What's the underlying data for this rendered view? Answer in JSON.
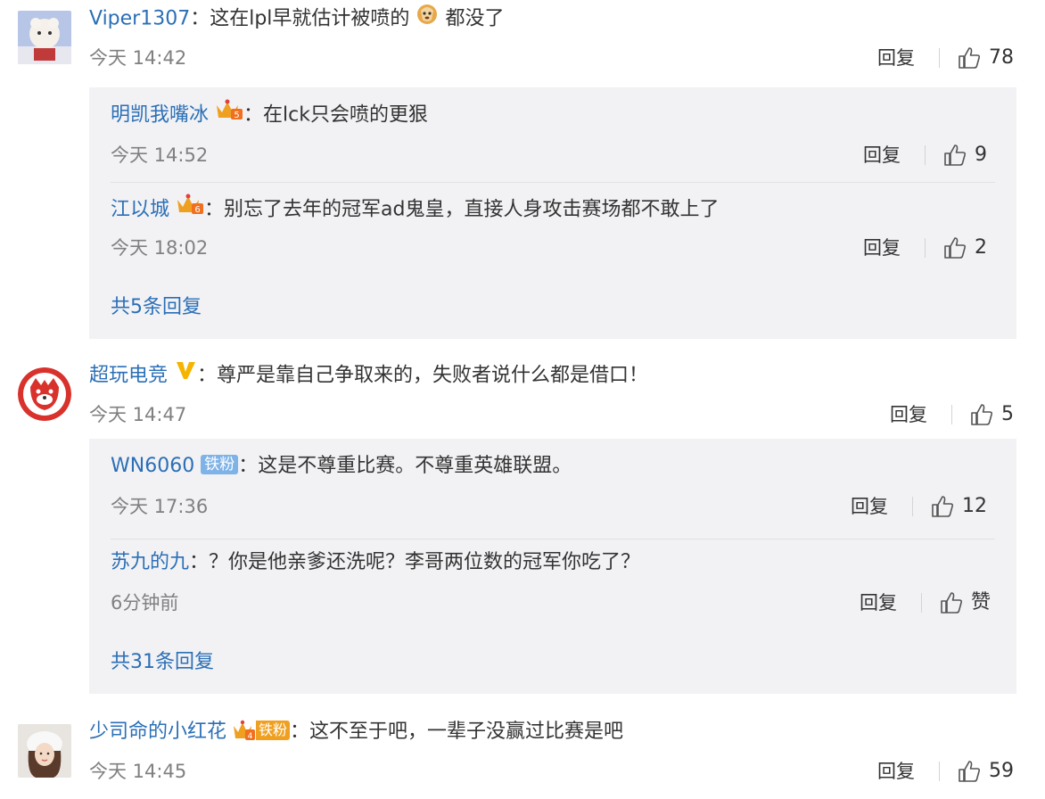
{
  "comments": [
    {
      "user": "Viper1307",
      "colon": "：",
      "text_before": "这在lpl早就估计被喷的",
      "text_after": "都没了",
      "time": "今天 14:42",
      "reply": "回复",
      "likes": "78",
      "replies": [
        {
          "user": "明凯我嘴冰",
          "colon": "：",
          "text": "在lck只会喷的更狠",
          "time": "今天 14:52",
          "reply": "回复",
          "likes": "9"
        },
        {
          "user": "江以城",
          "colon": "：",
          "text": "别忘了去年的冠军ad鬼皇，直接人身攻击赛场都不敢上了",
          "time": "今天 18:02",
          "reply": "回复",
          "likes": "2"
        }
      ],
      "more": "共5条回复"
    },
    {
      "user": "超玩电竞",
      "colon": "：",
      "text": "尊严是靠自己争取来的，失败者说什么都是借口！",
      "time": "今天 14:47",
      "reply": "回复",
      "likes": "5",
      "replies": [
        {
          "user": "WN6060",
          "badge": "铁粉",
          "colon": "：",
          "text": "这是不尊重比赛。不尊重英雄联盟。",
          "time": "今天 17:36",
          "reply": "回复",
          "likes": "12"
        },
        {
          "user": "苏九的九",
          "colon": "：",
          "text": "？你是他亲爹还洗呢？李哥两位数的冠军你吃了？",
          "time": "6分钟前",
          "reply": "回复",
          "likes": "赞"
        }
      ],
      "more": "共31条回复"
    },
    {
      "user": "少司命的小红花",
      "badge": "铁粉",
      "colon": "：",
      "text": "这不至于吧，一辈子没赢过比赛是吧",
      "time": "今天 14:45",
      "reply": "回复",
      "likes": "59"
    }
  ],
  "colors": {
    "username": "#2b6fb6",
    "time": "#808080",
    "reply_box": "#f2f2f5",
    "accent_badge": "#7fb3e8"
  },
  "icons": {
    "like": "thumbs-up-icon",
    "vip": "verified-v-icon",
    "crown": "crown-level-icon"
  }
}
